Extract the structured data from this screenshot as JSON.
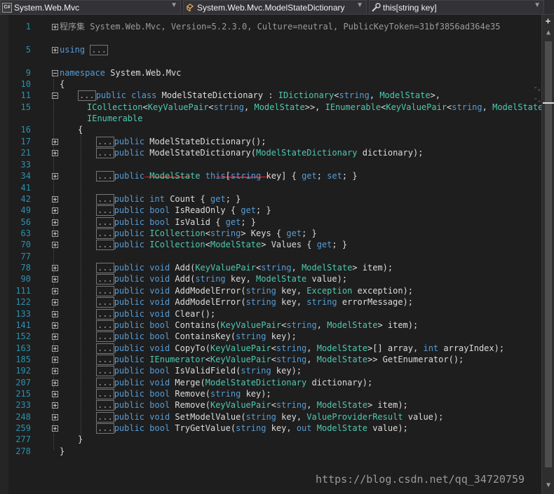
{
  "navbar": {
    "project_label": "System.Web.Mvc",
    "class_label": "System.Web.Mvc.ModelStateDictionary",
    "member_label": "this[string key]",
    "project_icon_text": "C#"
  },
  "lines": [
    {
      "n": "1",
      "segs": [
        [
          "gr",
          "程序集 System.Web.Mvc, Version=5.2.3.0, Culture=neutral, PublicKeyToken=31bf3856ad364e35"
        ]
      ]
    },
    {
      "n": "5",
      "segs": [
        [
          "kw",
          "using"
        ],
        [
          "txt",
          " "
        ],
        [
          "dots",
          "..."
        ]
      ]
    },
    {
      "n": "9",
      "segs": [
        [
          "kw",
          "namespace"
        ],
        [
          "txt",
          " System.Web.Mvc"
        ]
      ]
    },
    {
      "n": "10",
      "segs": [
        [
          "txt",
          "{"
        ]
      ]
    },
    {
      "n": "11",
      "segs": [
        [
          "dots",
          "..."
        ],
        [
          "kw",
          "public"
        ],
        [
          "txt",
          " "
        ],
        [
          "kw",
          "class"
        ],
        [
          "txt",
          " ModelStateDictionary : "
        ],
        [
          "ty",
          "IDictionary"
        ],
        [
          "txt",
          "<"
        ],
        [
          "kw",
          "string"
        ],
        [
          "txt",
          ", "
        ],
        [
          "ty",
          "ModelState"
        ],
        [
          "txt",
          ">,"
        ]
      ]
    },
    {
      "n": "15",
      "segs": [
        [
          "ty",
          "ICollection"
        ],
        [
          "txt",
          "<"
        ],
        [
          "ty",
          "KeyValuePair"
        ],
        [
          "txt",
          "<"
        ],
        [
          "kw",
          "string"
        ],
        [
          "txt",
          ", "
        ],
        [
          "ty",
          "ModelState"
        ],
        [
          "txt",
          ">>, "
        ],
        [
          "ty",
          "IEnumerable"
        ],
        [
          "txt",
          "<"
        ],
        [
          "ty",
          "KeyValuePair"
        ],
        [
          "txt",
          "<"
        ],
        [
          "kw",
          "string"
        ],
        [
          "txt",
          ", "
        ],
        [
          "ty",
          "ModelState"
        ],
        [
          "txt",
          ">>,"
        ]
      ]
    },
    {
      "n": "",
      "segs": [
        [
          "ty",
          "IEnumerable"
        ]
      ]
    },
    {
      "n": "16",
      "segs": [
        [
          "txt",
          "{"
        ]
      ]
    },
    {
      "n": "17",
      "segs": [
        [
          "dots",
          "..."
        ],
        [
          "kw",
          "public"
        ],
        [
          "txt",
          " ModelStateDictionary();"
        ]
      ]
    },
    {
      "n": "21",
      "segs": [
        [
          "dots",
          "..."
        ],
        [
          "kw",
          "public"
        ],
        [
          "txt",
          " ModelStateDictionary("
        ],
        [
          "ty",
          "ModelStateDictionary"
        ],
        [
          "txt",
          " dictionary);"
        ]
      ]
    },
    {
      "n": "33",
      "segs": []
    },
    {
      "n": "34",
      "segs": [
        [
          "dots",
          "..."
        ],
        [
          "kw",
          "public"
        ],
        [
          "txt",
          " "
        ],
        [
          "ty",
          "ModelState"
        ],
        [
          "txt",
          " "
        ],
        [
          "kw",
          "this"
        ],
        [
          "txt",
          "["
        ],
        [
          "kw",
          "string"
        ],
        [
          "txt",
          " key] { "
        ],
        [
          "kw",
          "get"
        ],
        [
          "txt",
          "; "
        ],
        [
          "kw",
          "set"
        ],
        [
          "txt",
          "; }"
        ]
      ]
    },
    {
      "n": "41",
      "segs": []
    },
    {
      "n": "42",
      "segs": [
        [
          "dots",
          "..."
        ],
        [
          "kw",
          "public"
        ],
        [
          "txt",
          " "
        ],
        [
          "kw",
          "int"
        ],
        [
          "txt",
          " Count { "
        ],
        [
          "kw",
          "get"
        ],
        [
          "txt",
          "; }"
        ]
      ]
    },
    {
      "n": "49",
      "segs": [
        [
          "dots",
          "..."
        ],
        [
          "kw",
          "public"
        ],
        [
          "txt",
          " "
        ],
        [
          "kw",
          "bool"
        ],
        [
          "txt",
          " IsReadOnly { "
        ],
        [
          "kw",
          "get"
        ],
        [
          "txt",
          "; }"
        ]
      ]
    },
    {
      "n": "56",
      "segs": [
        [
          "dots",
          "..."
        ],
        [
          "kw",
          "public"
        ],
        [
          "txt",
          " "
        ],
        [
          "kw",
          "bool"
        ],
        [
          "txt",
          " IsValid { "
        ],
        [
          "kw",
          "get"
        ],
        [
          "txt",
          "; }"
        ]
      ]
    },
    {
      "n": "63",
      "segs": [
        [
          "dots",
          "..."
        ],
        [
          "kw",
          "public"
        ],
        [
          "txt",
          " "
        ],
        [
          "ty",
          "ICollection"
        ],
        [
          "txt",
          "<"
        ],
        [
          "kw",
          "string"
        ],
        [
          "txt",
          "> Keys { "
        ],
        [
          "kw",
          "get"
        ],
        [
          "txt",
          "; }"
        ]
      ]
    },
    {
      "n": "70",
      "segs": [
        [
          "dots",
          "..."
        ],
        [
          "kw",
          "public"
        ],
        [
          "txt",
          " "
        ],
        [
          "ty",
          "ICollection"
        ],
        [
          "txt",
          "<"
        ],
        [
          "ty",
          "ModelState"
        ],
        [
          "txt",
          "> Values { "
        ],
        [
          "kw",
          "get"
        ],
        [
          "txt",
          "; }"
        ]
      ]
    },
    {
      "n": "77",
      "segs": []
    },
    {
      "n": "78",
      "segs": [
        [
          "dots",
          "..."
        ],
        [
          "kw",
          "public"
        ],
        [
          "txt",
          " "
        ],
        [
          "kw",
          "void"
        ],
        [
          "txt",
          " Add("
        ],
        [
          "ty",
          "KeyValuePair"
        ],
        [
          "txt",
          "<"
        ],
        [
          "kw",
          "string"
        ],
        [
          "txt",
          ", "
        ],
        [
          "ty",
          "ModelState"
        ],
        [
          "txt",
          "> item);"
        ]
      ]
    },
    {
      "n": "90",
      "segs": [
        [
          "dots",
          "..."
        ],
        [
          "kw",
          "public"
        ],
        [
          "txt",
          " "
        ],
        [
          "kw",
          "void"
        ],
        [
          "txt",
          " Add("
        ],
        [
          "kw",
          "string"
        ],
        [
          "txt",
          " key, "
        ],
        [
          "ty",
          "ModelState"
        ],
        [
          "txt",
          " value);"
        ]
      ]
    },
    {
      "n": "111",
      "segs": [
        [
          "dots",
          "..."
        ],
        [
          "kw",
          "public"
        ],
        [
          "txt",
          " "
        ],
        [
          "kw",
          "void"
        ],
        [
          "txt",
          " AddModelError("
        ],
        [
          "kw",
          "string"
        ],
        [
          "txt",
          " key, "
        ],
        [
          "ty",
          "Exception"
        ],
        [
          "txt",
          " exception);"
        ]
      ]
    },
    {
      "n": "122",
      "segs": [
        [
          "dots",
          "..."
        ],
        [
          "kw",
          "public"
        ],
        [
          "txt",
          " "
        ],
        [
          "kw",
          "void"
        ],
        [
          "txt",
          " AddModelError("
        ],
        [
          "kw",
          "string"
        ],
        [
          "txt",
          " key, "
        ],
        [
          "kw",
          "string"
        ],
        [
          "txt",
          " errorMessage);"
        ]
      ]
    },
    {
      "n": "133",
      "segs": [
        [
          "dots",
          "..."
        ],
        [
          "kw",
          "public"
        ],
        [
          "txt",
          " "
        ],
        [
          "kw",
          "void"
        ],
        [
          "txt",
          " Clear();"
        ]
      ]
    },
    {
      "n": "141",
      "segs": [
        [
          "dots",
          "..."
        ],
        [
          "kw",
          "public"
        ],
        [
          "txt",
          " "
        ],
        [
          "kw",
          "bool"
        ],
        [
          "txt",
          " Contains("
        ],
        [
          "ty",
          "KeyValuePair"
        ],
        [
          "txt",
          "<"
        ],
        [
          "kw",
          "string"
        ],
        [
          "txt",
          ", "
        ],
        [
          "ty",
          "ModelState"
        ],
        [
          "txt",
          "> item);"
        ]
      ]
    },
    {
      "n": "152",
      "segs": [
        [
          "dots",
          "..."
        ],
        [
          "kw",
          "public"
        ],
        [
          "txt",
          " "
        ],
        [
          "kw",
          "bool"
        ],
        [
          "txt",
          " ContainsKey("
        ],
        [
          "kw",
          "string"
        ],
        [
          "txt",
          " key);"
        ]
      ]
    },
    {
      "n": "163",
      "segs": [
        [
          "dots",
          "..."
        ],
        [
          "kw",
          "public"
        ],
        [
          "txt",
          " "
        ],
        [
          "kw",
          "void"
        ],
        [
          "txt",
          " CopyTo("
        ],
        [
          "ty",
          "KeyValuePair"
        ],
        [
          "txt",
          "<"
        ],
        [
          "kw",
          "string"
        ],
        [
          "txt",
          ", "
        ],
        [
          "ty",
          "ModelState"
        ],
        [
          "txt",
          ">[] array, "
        ],
        [
          "kw",
          "int"
        ],
        [
          "txt",
          " arrayIndex);"
        ]
      ]
    },
    {
      "n": "185",
      "segs": [
        [
          "dots",
          "..."
        ],
        [
          "kw",
          "public"
        ],
        [
          "txt",
          " "
        ],
        [
          "ty",
          "IEnumerator"
        ],
        [
          "txt",
          "<"
        ],
        [
          "ty",
          "KeyValuePair"
        ],
        [
          "txt",
          "<"
        ],
        [
          "kw",
          "string"
        ],
        [
          "txt",
          ", "
        ],
        [
          "ty",
          "ModelState"
        ],
        [
          "txt",
          ">> GetEnumerator();"
        ]
      ]
    },
    {
      "n": "192",
      "segs": [
        [
          "dots",
          "..."
        ],
        [
          "kw",
          "public"
        ],
        [
          "txt",
          " "
        ],
        [
          "kw",
          "bool"
        ],
        [
          "txt",
          " IsValidField("
        ],
        [
          "kw",
          "string"
        ],
        [
          "txt",
          " key);"
        ]
      ]
    },
    {
      "n": "207",
      "segs": [
        [
          "dots",
          "..."
        ],
        [
          "kw",
          "public"
        ],
        [
          "txt",
          " "
        ],
        [
          "kw",
          "void"
        ],
        [
          "txt",
          " Merge("
        ],
        [
          "ty",
          "ModelStateDictionary"
        ],
        [
          "txt",
          " dictionary);"
        ]
      ]
    },
    {
      "n": "215",
      "segs": [
        [
          "dots",
          "..."
        ],
        [
          "kw",
          "public"
        ],
        [
          "txt",
          " "
        ],
        [
          "kw",
          "bool"
        ],
        [
          "txt",
          " Remove("
        ],
        [
          "kw",
          "string"
        ],
        [
          "txt",
          " key);"
        ]
      ]
    },
    {
      "n": "233",
      "segs": [
        [
          "dots",
          "..."
        ],
        [
          "kw",
          "public"
        ],
        [
          "txt",
          " "
        ],
        [
          "kw",
          "bool"
        ],
        [
          "txt",
          " Remove("
        ],
        [
          "ty",
          "KeyValuePair"
        ],
        [
          "txt",
          "<"
        ],
        [
          "kw",
          "string"
        ],
        [
          "txt",
          ", "
        ],
        [
          "ty",
          "ModelState"
        ],
        [
          "txt",
          "> item);"
        ]
      ]
    },
    {
      "n": "248",
      "segs": [
        [
          "dots",
          "..."
        ],
        [
          "kw",
          "public"
        ],
        [
          "txt",
          " "
        ],
        [
          "kw",
          "void"
        ],
        [
          "txt",
          " SetModelValue("
        ],
        [
          "kw",
          "string"
        ],
        [
          "txt",
          " key, "
        ],
        [
          "ty",
          "ValueProviderResult"
        ],
        [
          "txt",
          " value);"
        ]
      ]
    },
    {
      "n": "259",
      "segs": [
        [
          "dots",
          "..."
        ],
        [
          "kw",
          "public"
        ],
        [
          "txt",
          " "
        ],
        [
          "kw",
          "bool"
        ],
        [
          "txt",
          " TryGetValue("
        ],
        [
          "kw",
          "string"
        ],
        [
          "txt",
          " key, "
        ],
        [
          "kw",
          "out"
        ],
        [
          "txt",
          " "
        ],
        [
          "ty",
          "ModelState"
        ],
        [
          "txt",
          " value);"
        ]
      ]
    },
    {
      "n": "277",
      "segs": [
        [
          "txt",
          "}"
        ]
      ]
    },
    {
      "n": "278",
      "segs": [
        [
          "txt",
          "}"
        ]
      ]
    }
  ],
  "watermark": "https://blog.csdn.net/qq_34720759",
  "colors": {
    "keyword": "#569cd6",
    "type": "#4ec9b0",
    "line_number": "#2b91af",
    "annotation_red": "#e21c1c",
    "background": "#1e1e1e"
  }
}
